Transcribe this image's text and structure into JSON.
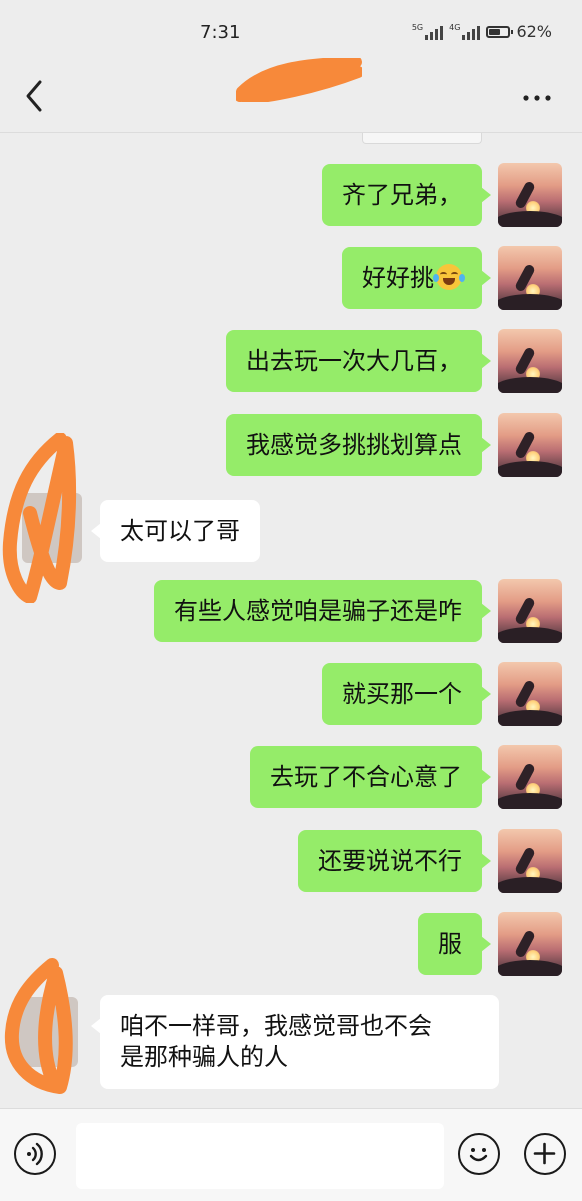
{
  "status_bar": {
    "time": "7:31",
    "network_1": "5G",
    "network_2": "4G",
    "battery_level": 0.62,
    "battery_text": "62%"
  },
  "header": {
    "title": "",
    "back_icon": "chevron-left-icon",
    "more_icon": "more-dots-icon"
  },
  "messages": [
    {
      "from": "me",
      "text": "齐了兄弟，"
    },
    {
      "from": "me",
      "text": "好好挑",
      "emoji": "laughing-tears-emoji"
    },
    {
      "from": "me",
      "text": "出去玩一次大几百，"
    },
    {
      "from": "me",
      "text": "我感觉多挑挑划算点"
    },
    {
      "from": "other",
      "text": "太可以了哥"
    },
    {
      "from": "me",
      "text": "有些人感觉咱是骗子还是咋"
    },
    {
      "from": "me",
      "text": "就买那一个"
    },
    {
      "from": "me",
      "text": "去玩了不合心意了"
    },
    {
      "from": "me",
      "text": "还要说说不行"
    },
    {
      "from": "me",
      "text": "服"
    },
    {
      "from": "other",
      "text_line1": "咱不一样哥，我感觉哥也不会",
      "text_line2": "是那种骗人的人"
    }
  ],
  "input_bar": {
    "voice_icon": "voice-icon",
    "emoji_icon": "smiley-icon",
    "plus_icon": "plus-icon",
    "input_value": ""
  },
  "colors": {
    "background": "#ededed",
    "my_bubble": "#95ec69",
    "other_bubble": "#ffffff",
    "redaction": "#f7893a"
  }
}
